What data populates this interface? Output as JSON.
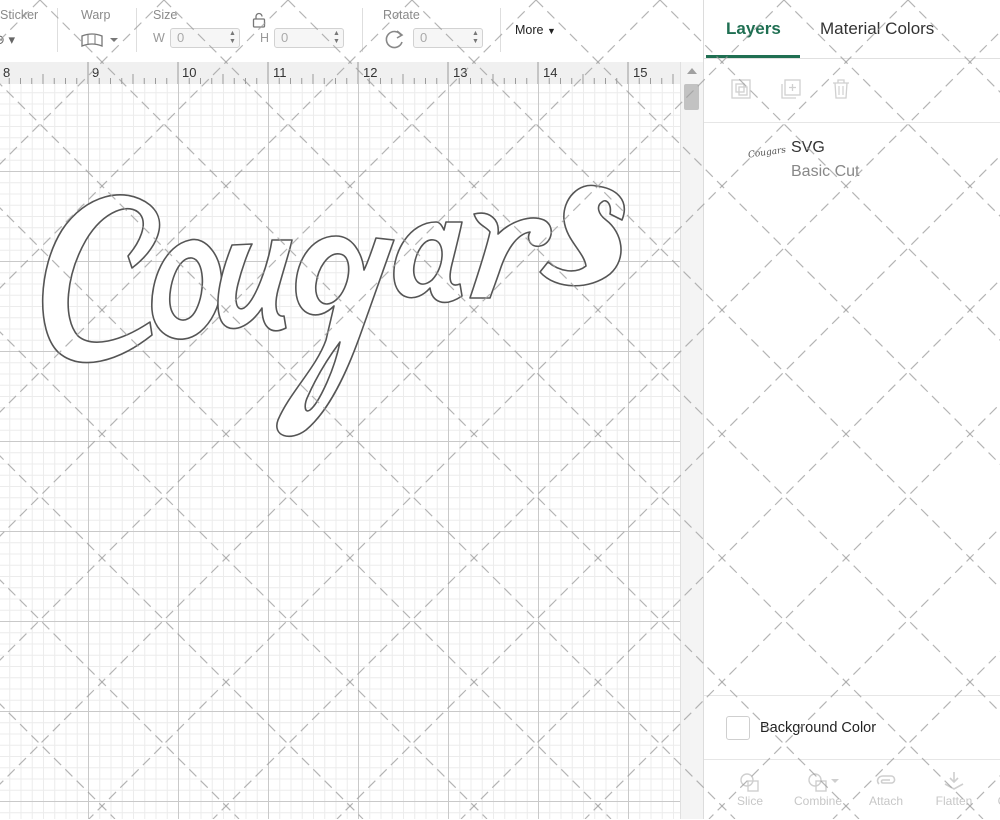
{
  "toolbar": {
    "sticker_label": "Sticker",
    "warp_label": "Warp",
    "size_label": "Size",
    "width_prefix": "W",
    "width_value": "0",
    "height_prefix": "H",
    "height_value": "0",
    "rotate_label": "Rotate",
    "rotate_value": "0",
    "more_label": "More"
  },
  "ruler": {
    "ticks": [
      "8",
      "9",
      "10",
      "11",
      "12",
      "13",
      "14",
      "15"
    ]
  },
  "canvas": {
    "artwork_text": "Cougars",
    "artwork_icon": "cougars-script-outline"
  },
  "panel": {
    "tabs": [
      {
        "label": "Layers",
        "active": true
      },
      {
        "label": "Material Colors",
        "active": false
      }
    ],
    "layer_tools": [
      "group-icon",
      "duplicate-icon",
      "delete-icon"
    ],
    "layers": [
      {
        "name": "SVG",
        "operation": "Basic Cut",
        "thumb_text": "Cougars"
      }
    ],
    "background_color_label": "Background Color",
    "bottom_tools": [
      {
        "label": "Slice",
        "icon": "slice-icon"
      },
      {
        "label": "Combine",
        "icon": "combine-icon"
      },
      {
        "label": "Attach",
        "icon": "attach-icon"
      },
      {
        "label": "Flatten",
        "icon": "flatten-icon"
      },
      {
        "label": "C",
        "icon": "contour-icon"
      }
    ]
  },
  "colors": {
    "accent": "#1f6f52",
    "grid_major": "#c9c9c9",
    "grid_minor": "#ececec",
    "outline": "#555555"
  }
}
